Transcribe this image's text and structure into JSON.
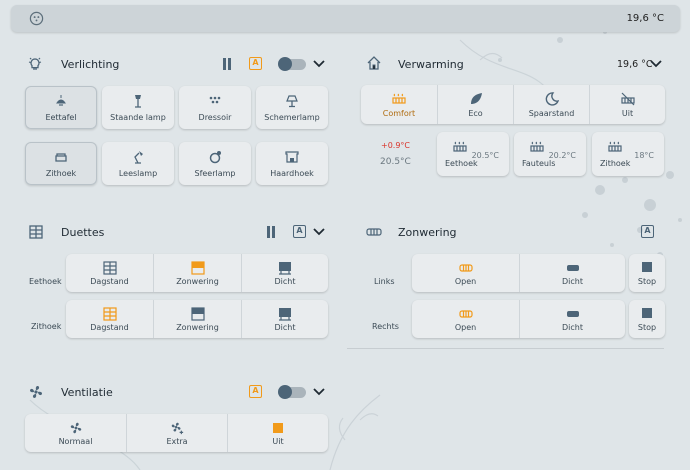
{
  "topbar": {
    "temperature": "19,6 °C"
  },
  "verlichting": {
    "title": "Verlichting",
    "mode_badge": "A",
    "lights": [
      {
        "label": "Eettafel",
        "icon": "ceiling-light-icon",
        "active": true
      },
      {
        "label": "Staande lamp",
        "icon": "floor-lamp-icon",
        "active": false
      },
      {
        "label": "Dressoir",
        "icon": "dots-light-icon",
        "active": false
      },
      {
        "label": "Schemerlamp",
        "icon": "table-lamp-icon",
        "active": false
      },
      {
        "label": "Zithoek",
        "icon": "sofa-icon",
        "active": true
      },
      {
        "label": "Leeslamp",
        "icon": "desk-lamp-icon",
        "active": false
      },
      {
        "label": "Sfeerlamp",
        "icon": "spotlight-icon",
        "active": false
      },
      {
        "label": "Haardhoek",
        "icon": "fireplace-icon",
        "active": false
      }
    ]
  },
  "verwarming": {
    "title": "Verwarming",
    "temperature": "19,6 °C",
    "modes": [
      {
        "label": "Comfort",
        "icon": "radiator-icon",
        "active": true
      },
      {
        "label": "Eco",
        "icon": "leaf-icon",
        "active": false
      },
      {
        "label": "Spaarstand",
        "icon": "moon-icon",
        "active": false
      },
      {
        "label": "Uit",
        "icon": "radiator-off-icon",
        "active": false
      }
    ],
    "offset": "+0.9°C",
    "current": "20.5°C",
    "zones": [
      {
        "label": "Eethoek",
        "temp": "20.5°C"
      },
      {
        "label": "Fauteuls",
        "temp": "20.2°C"
      },
      {
        "label": "Zithoek",
        "temp": "18°C"
      }
    ]
  },
  "duettes": {
    "title": "Duettes",
    "mode_badge": "A",
    "rows": [
      {
        "name": "Eethoek",
        "options": [
          {
            "label": "Dagstand",
            "active": false
          },
          {
            "label": "Zonwering",
            "active": true
          },
          {
            "label": "Dicht",
            "active": false
          }
        ]
      },
      {
        "name": "Zithoek",
        "options": [
          {
            "label": "Dagstand",
            "active": true
          },
          {
            "label": "Zonwering",
            "active": false
          },
          {
            "label": "Dicht",
            "active": false
          }
        ]
      }
    ]
  },
  "zonwering": {
    "title": "Zonwering",
    "mode_badge": "A",
    "rows": [
      {
        "name": "Links",
        "open": "Open",
        "dicht": "Dicht",
        "stop": "Stop"
      },
      {
        "name": "Rechts",
        "open": "Open",
        "dicht": "Dicht",
        "stop": "Stop"
      }
    ]
  },
  "ventilatie": {
    "title": "Ventilatie",
    "mode_badge": "A",
    "options": [
      {
        "label": "Normaal",
        "active": false
      },
      {
        "label": "Extra",
        "active": false
      },
      {
        "label": "Uit",
        "active": true
      }
    ]
  },
  "colors": {
    "accent": "#f19a1a",
    "icon": "#4d6578",
    "tile": "#e9ecee"
  }
}
